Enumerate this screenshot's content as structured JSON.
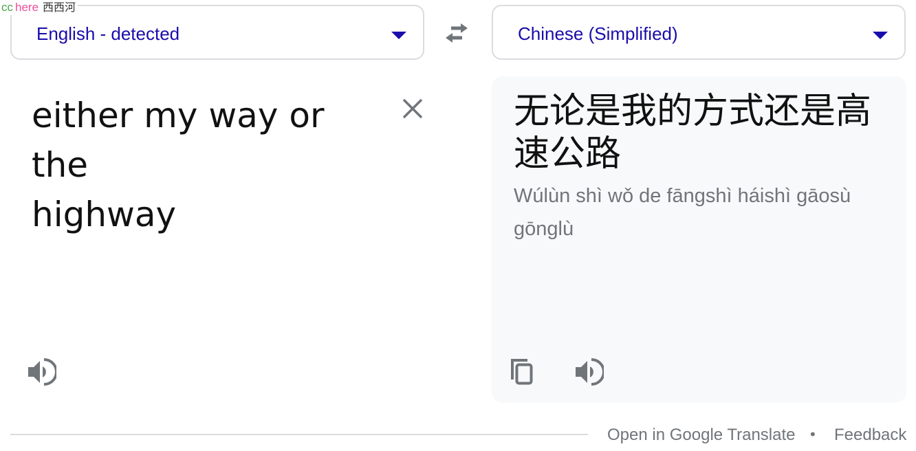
{
  "watermark": {
    "cc": "cc",
    "here": "here",
    "name": "西西河"
  },
  "source_language": {
    "label": "English - detected"
  },
  "target_language": {
    "label": "Chinese (Simplified)"
  },
  "swap_button": {
    "icon": "swap-arrows-icon"
  },
  "source": {
    "text": "either my way or\nthe\nhighway",
    "clear_icon": "close-icon",
    "listen_icon": "speaker-icon"
  },
  "target": {
    "text": "无论是我的方式还是高速公路",
    "romanization": "Wúlùn shì wǒ de fāngshì háishì gāosù gōnglù",
    "copy_icon": "copy-icon",
    "listen_icon": "speaker-icon"
  },
  "footer": {
    "open_link": "Open in Google Translate",
    "separator": "•",
    "feedback_link": "Feedback"
  },
  "colors": {
    "accent": "#1a0dab",
    "icon_gray": "#70757a",
    "border": "#dadce0",
    "panel_bg": "#f8f9fa"
  }
}
